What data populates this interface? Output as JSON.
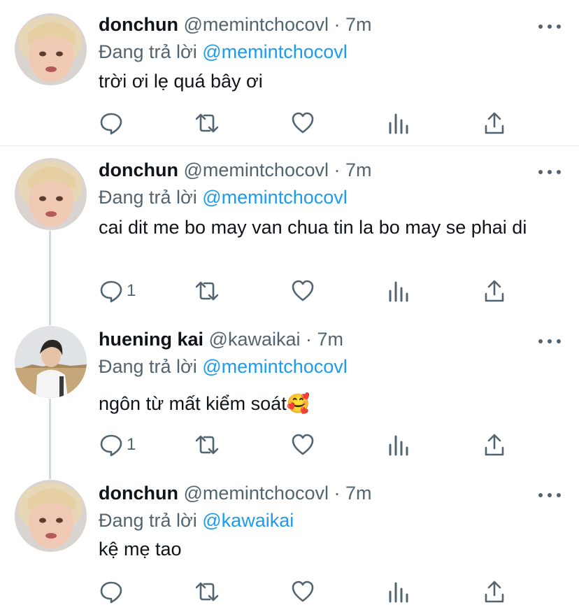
{
  "tweets": [
    {
      "name": "donchun",
      "handle": "@memintchocovl",
      "dot": "·",
      "time": "7m",
      "reply_prefix": "Đang trả lời ",
      "reply_to": "@memintchocovl",
      "text": "trời ơi lẹ quá bây ơi",
      "reply_count": "",
      "avatar": "toddler-avatar"
    },
    {
      "name": "donchun",
      "handle": "@memintchocovl",
      "dot": "·",
      "time": "7m",
      "reply_prefix": "Đang trả lời ",
      "reply_to": "@memintchocovl",
      "text": "cai dit me bo may van chua tin la bo may se phai di",
      "reply_count": "1",
      "avatar": "toddler-avatar"
    },
    {
      "name": "huening kai",
      "handle": "@kawaikai",
      "dot": "·",
      "time": "7m",
      "reply_prefix": "Đang trả lời ",
      "reply_to": "@memintchocovl",
      "text": "ngôn từ mất kiểm soát🥰",
      "reply_count": "1",
      "avatar": "hoodie-person-avatar"
    },
    {
      "name": "donchun",
      "handle": "@memintchocovl",
      "dot": "·",
      "time": "7m",
      "reply_prefix": "Đang trả lời ",
      "reply_to": "@kawaikai",
      "text": "kệ mẹ tao",
      "reply_count": "",
      "avatar": "toddler-avatar"
    }
  ],
  "icons": {
    "more": "more-horizontal-icon",
    "reply": "reply-bubble-icon",
    "retweet": "retweet-icon",
    "like": "heart-icon",
    "analytics": "analytics-bars-icon",
    "share": "share-upload-icon"
  },
  "colors": {
    "text": "#0f1419",
    "secondary": "#536471",
    "link": "#1d9bf0",
    "thread_line": "#cfd9de",
    "divider": "#e6e9ea"
  }
}
